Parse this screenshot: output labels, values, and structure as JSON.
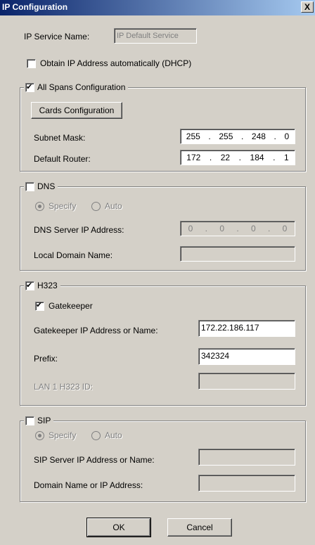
{
  "window": {
    "title": "IP Configuration",
    "close_glyph": "X"
  },
  "service": {
    "label": "IP Service Name:",
    "value": "IP Default Service"
  },
  "dhcp": {
    "label": "Obtain IP Address automatically (DHCP)",
    "checked": false
  },
  "spans": {
    "legend": "All Spans Configuration",
    "checked": true,
    "cards_button": "Cards Configuration",
    "subnet_label": "Subnet Mask:",
    "subnet": [
      "255",
      "255",
      "248",
      "0"
    ],
    "router_label": "Default Router:",
    "router": [
      "172",
      "22",
      "184",
      "1"
    ]
  },
  "dns": {
    "legend": "DNS",
    "checked": false,
    "specify_label": "Specify",
    "auto_label": "Auto",
    "server_label": "DNS Server IP Address:",
    "server": [
      "0",
      "0",
      "0",
      "0"
    ],
    "domain_label": "Local Domain Name:",
    "domain_value": ""
  },
  "h323": {
    "legend": "H323",
    "checked": true,
    "gatekeeper_label": "Gatekeeper",
    "gatekeeper_checked": true,
    "gk_address_label": "Gatekeeper IP Address or Name:",
    "gk_address_value": "172.22.186.117",
    "prefix_label": "Prefix:",
    "prefix_value": "342324",
    "lan_id_label": "LAN 1 H323 ID:",
    "lan_id_value": ""
  },
  "sip": {
    "legend": "SIP",
    "checked": false,
    "specify_label": "Specify",
    "auto_label": "Auto",
    "server_label": "SIP Server IP Address or Name:",
    "server_value": "",
    "domain_label": "Domain Name or IP Address:",
    "domain_value": ""
  },
  "buttons": {
    "ok": "OK",
    "cancel": "Cancel"
  }
}
